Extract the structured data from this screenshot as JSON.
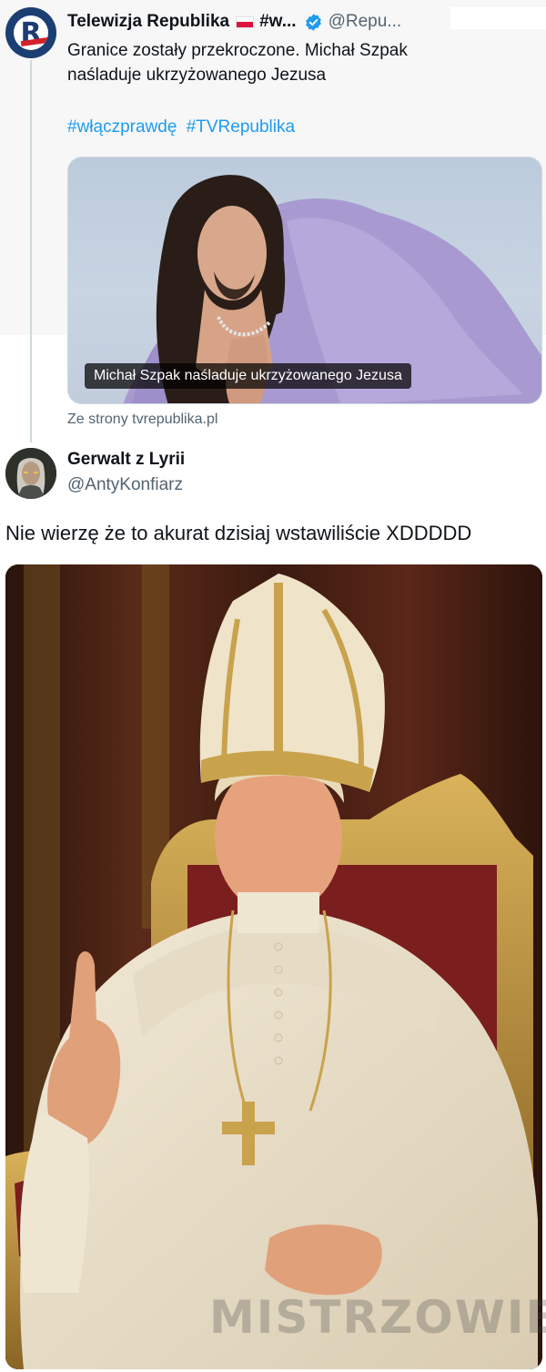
{
  "quoted_tweet": {
    "display_name": "Telewizja Republika",
    "name_suffix": "#w...",
    "handle": "@Repu...",
    "text_lines": [
      "Granice zostały przekroczone. Michał Szpak",
      "naśladuje ukrzyżowanego Jezusa"
    ],
    "hashtags": [
      "#włączprawdę",
      "#TVRepublika"
    ],
    "card": {
      "caption": "Michał Szpak naśladuje ukrzyżowanego Jezusa",
      "source": "Ze strony tvrepublika.pl"
    },
    "avatar_icon": "tv-republika-logo-icon",
    "verified_icon": "verified-badge-icon",
    "flag_icon": "poland-flag-icon",
    "colors": {
      "link": "#1d9bf0",
      "verified": "#1d9bf0",
      "logo_blue": "#1b3e73",
      "logo_red": "#d4202a"
    }
  },
  "reply_tweet": {
    "display_name": "Gerwalt z Lyrii",
    "handle": "@AntyKonfiarz",
    "text": "Nie wierzę że to akurat dzisiaj wstawiliście XDDDDD",
    "avatar_icon": "witcher-avatar-icon",
    "photo_icon": "pope-portrait-image"
  },
  "watermark": {
    "text": "MISTRZOWIE"
  }
}
